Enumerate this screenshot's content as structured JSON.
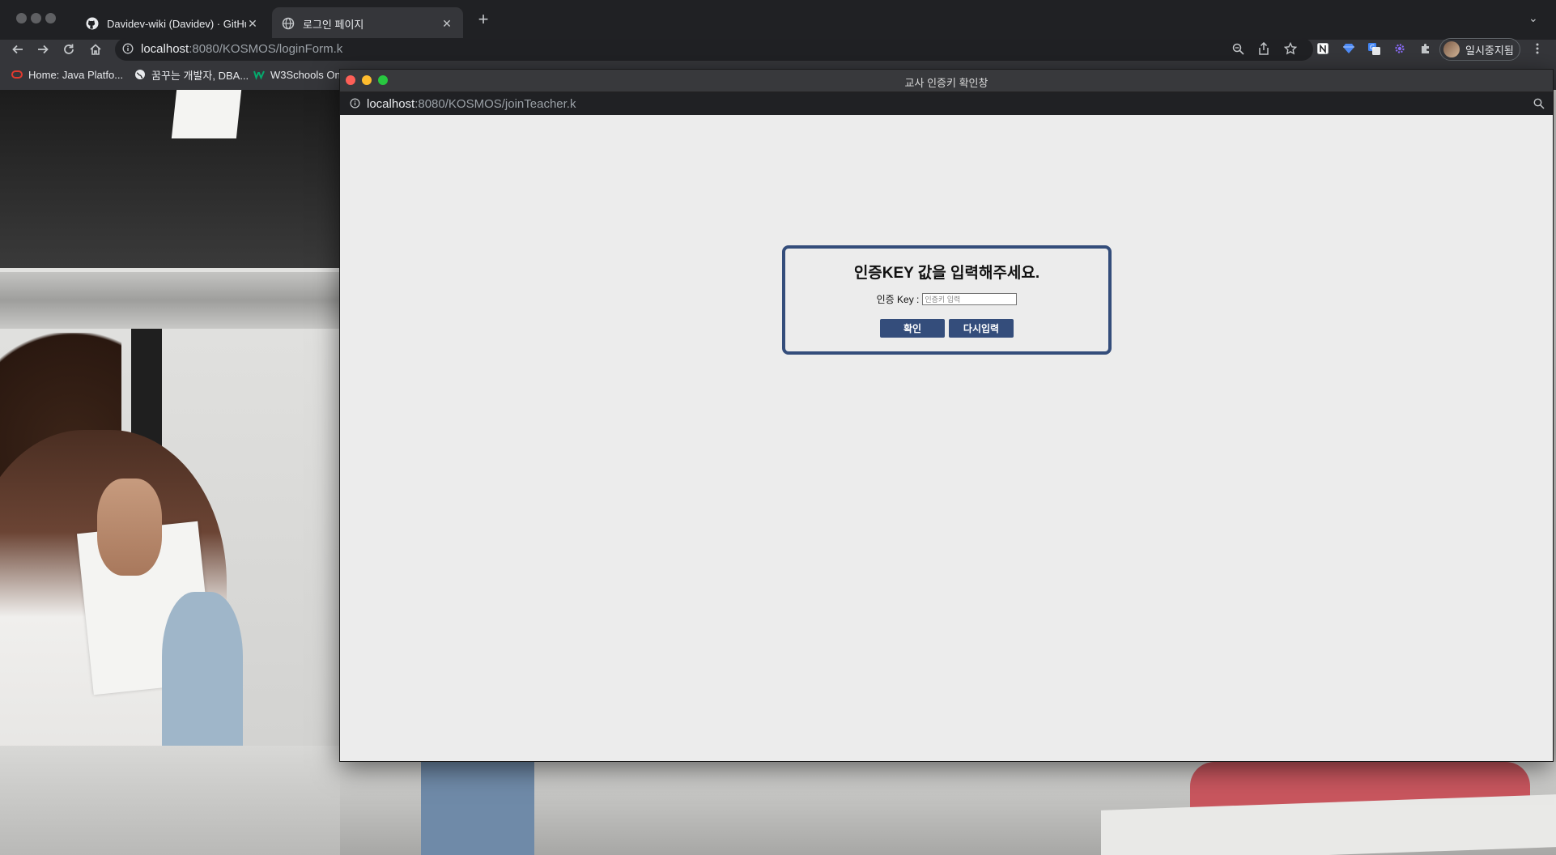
{
  "browser": {
    "tabs": [
      {
        "label": "Davidev-wiki (Davidev) · GitHu",
        "icon": "github-icon",
        "active": false
      },
      {
        "label": "로그인 페이지",
        "icon": "globe-icon",
        "active": true
      }
    ],
    "address": {
      "host": "localhost",
      "path": ":8080/KOSMOS/loginForm.k"
    },
    "profile_label": "일시중지됨",
    "bookmarks": [
      {
        "label": "Home: Java Platfo...",
        "icon": "oracle-icon"
      },
      {
        "label": "꿈꾸는 개발자, DBA...",
        "icon": "globe-icon"
      },
      {
        "label": "W3Schools On",
        "icon": "w3schools-icon"
      }
    ]
  },
  "popup": {
    "title": "교사 인증키 확인창",
    "address": {
      "host": "localhost",
      "path": ":8080/KOSMOS/joinTeacher.k"
    }
  },
  "auth_form": {
    "heading": "인증KEY 값을 입력해주세요.",
    "key_label": "인증 Key :",
    "key_placeholder": "인증키 입력",
    "key_value": "",
    "confirm_label": "확인",
    "reset_label": "다시입력"
  },
  "colors": {
    "accent": "#344d7b",
    "popup_background": "#ececec",
    "chrome_dark": "#202124"
  }
}
